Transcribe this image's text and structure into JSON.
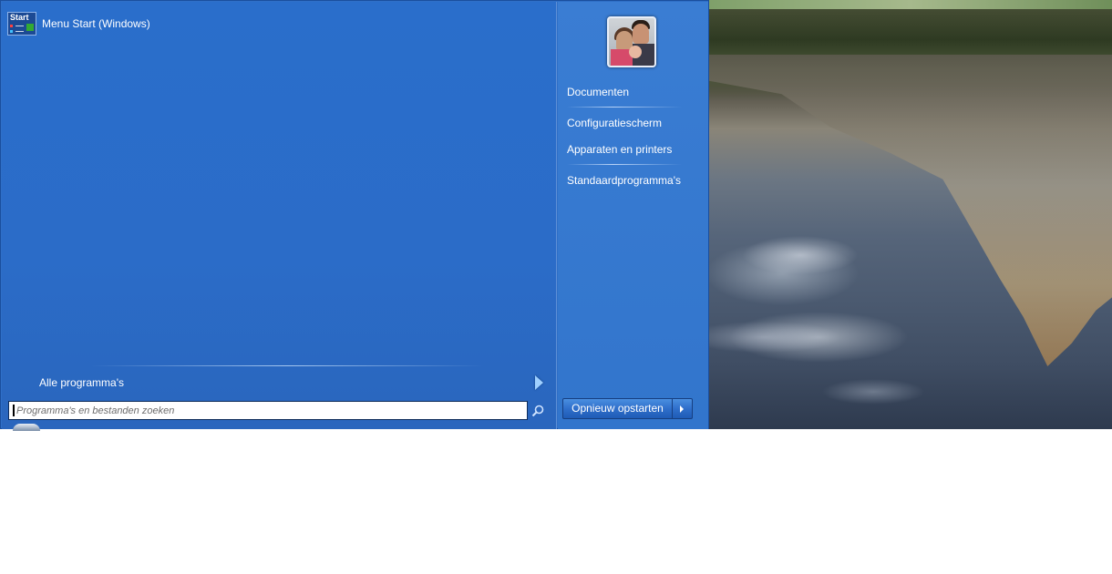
{
  "start_menu": {
    "programs": [
      {
        "label": "Menu Start (Windows)",
        "icon": "start-menu-app-icon",
        "icon_text": "Start"
      }
    ],
    "all_programs_label": "Alle programma's",
    "search": {
      "placeholder": "Programma's en bestanden zoeken",
      "value": ""
    },
    "right_pane": {
      "user_picture": "user-picture",
      "links": [
        "Documenten",
        "Configuratiescherm",
        "Apparaten en printers",
        "Standaardprogramma's"
      ]
    },
    "shutdown_label": "Opnieuw opstarten",
    "accent": "#2b6cc8"
  }
}
